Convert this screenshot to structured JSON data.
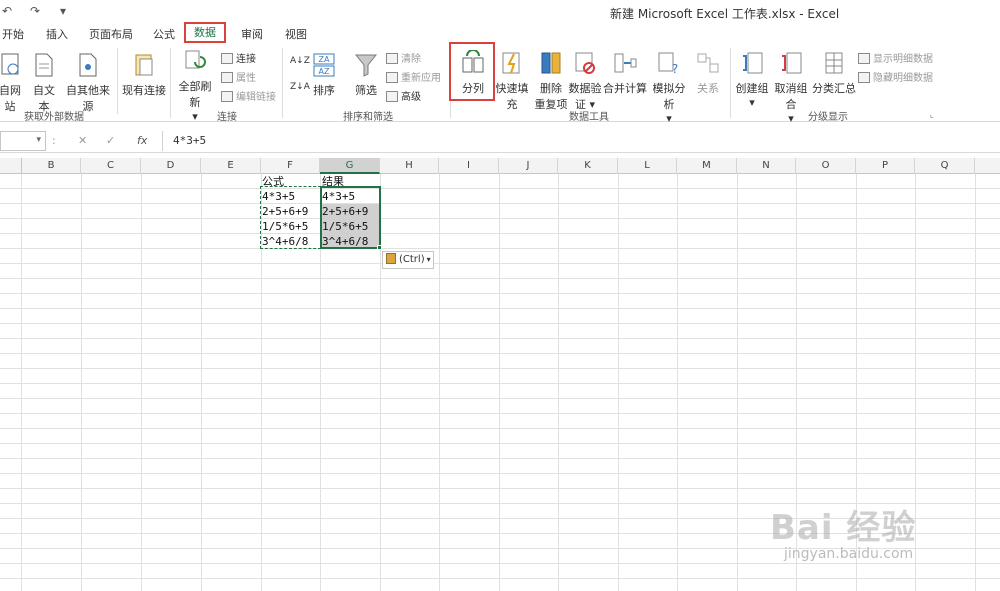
{
  "titlebar": {
    "title": "新建 Microsoft Excel 工作表.xlsx - Excel",
    "undo_glyph": "↶",
    "redo_glyph": "↷",
    "customize_glyph": "▾"
  },
  "tabs": {
    "home": "开始",
    "insert": "插入",
    "page_layout": "页面布局",
    "formulas": "公式",
    "data": "数据",
    "review": "审阅",
    "view": "视图"
  },
  "ribbon": {
    "from_web": "自网站",
    "from_text": "自文本",
    "from_other": "自其他来源",
    "existing_conn": "现有连接",
    "refresh_all": "全部刷新",
    "refresh_caret": "▾",
    "connections": "连接",
    "properties": "属性",
    "edit_links": "编辑链接",
    "sort_az": "A↓Z",
    "sort_za": "Z↓A",
    "sort": "排序",
    "filter": "筛选",
    "clear": "清除",
    "reapply": "重新应用",
    "advanced": "高级",
    "text_to_columns": "分列",
    "flash_fill": "快速填充",
    "remove_dup_1": "删除",
    "remove_dup_2": "重复项",
    "data_valid_1": "数据验",
    "data_valid_2": "证 ▾",
    "consolidate": "合并计算",
    "what_if": "模拟分析",
    "what_if_caret": "▾",
    "relationships": "关系",
    "group": "创建组",
    "group_caret": "▾",
    "ungroup": "取消组合",
    "ungroup_caret": "▾",
    "subtotal": "分类汇总",
    "show_detail": "显示明细数据",
    "hide_detail": "隐藏明细数据",
    "group_get_external": "获取外部数据",
    "group_connections": "连接",
    "group_sort_filter": "排序和筛选",
    "group_data_tools": "数据工具",
    "group_outline": "分级显示"
  },
  "formula_bar": {
    "namebox_caret": "▾",
    "colon": ":",
    "cancel": "✕",
    "enter": "✓",
    "fx": "fx",
    "value": "4*3+5"
  },
  "columns": [
    "B",
    "C",
    "D",
    "E",
    "F",
    "G",
    "H",
    "I",
    "J",
    "K",
    "L",
    "M",
    "N",
    "O",
    "P",
    "Q"
  ],
  "cells": {
    "f_header": "公式",
    "g_header": "结果",
    "f_rows": [
      "4*3+5",
      "2+5+6+9",
      "1/5*6+5",
      "3^4+6/8"
    ],
    "g_rows": [
      "4*3+5",
      "2+5+6+9",
      "1/5*6+5",
      "3^4+6/8"
    ]
  },
  "paste_options": {
    "label": "(Ctrl)",
    "caret": "▾"
  },
  "watermark": {
    "brand": "Bai 经验",
    "url": "jingyan.baidu.com"
  },
  "colors": {
    "excel_green": "#217346",
    "highlight_red": "#d9413c"
  }
}
